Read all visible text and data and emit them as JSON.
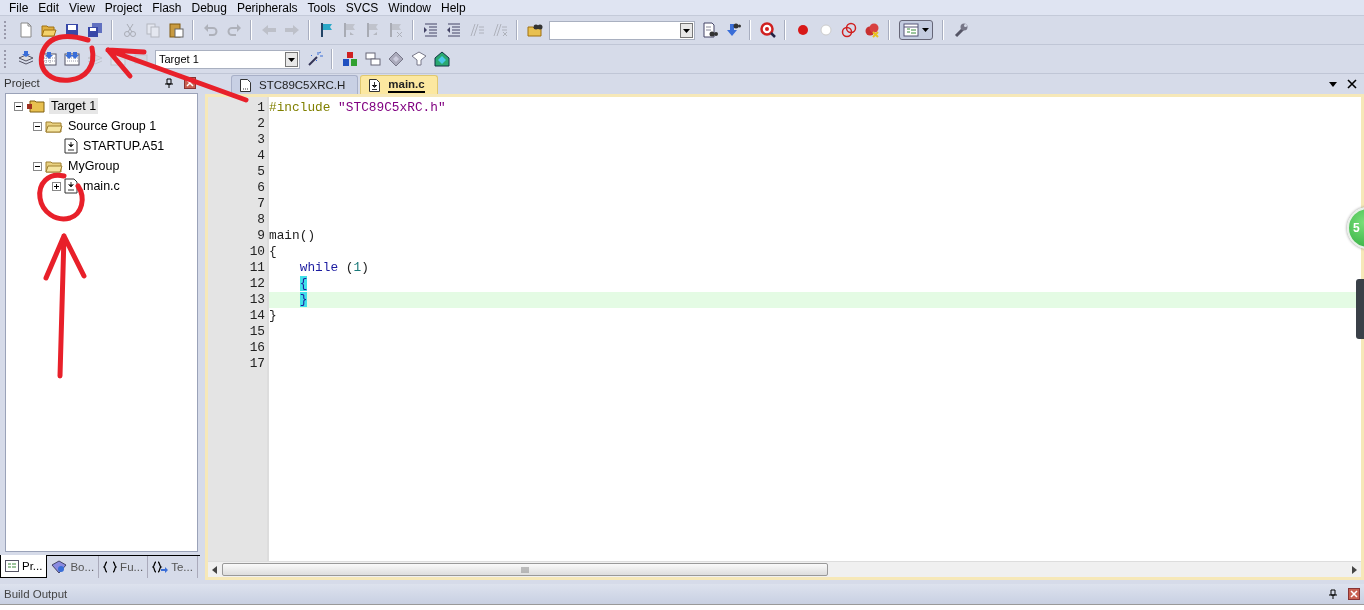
{
  "menu": [
    {
      "label": "File"
    },
    {
      "label": "Edit"
    },
    {
      "label": "View"
    },
    {
      "label": "Project"
    },
    {
      "label": "Flash"
    },
    {
      "label": "Debug"
    },
    {
      "label": "Peripherals"
    },
    {
      "label": "Tools"
    },
    {
      "label": "SVCS"
    },
    {
      "label": "Window"
    },
    {
      "label": "Help"
    }
  ],
  "toolbar_1": [
    {
      "kind": "new",
      "disabled": false
    },
    {
      "kind": "open",
      "disabled": false
    },
    {
      "kind": "save",
      "disabled": false
    },
    {
      "kind": "saveall",
      "disabled": false
    },
    {
      "kind": "sep"
    },
    {
      "kind": "cut",
      "disabled": true
    },
    {
      "kind": "copy",
      "disabled": true
    },
    {
      "kind": "paste",
      "disabled": false
    },
    {
      "kind": "sep"
    },
    {
      "kind": "undo",
      "disabled": true
    },
    {
      "kind": "redo",
      "disabled": true
    },
    {
      "kind": "sep"
    },
    {
      "kind": "back",
      "disabled": true
    },
    {
      "kind": "forward",
      "disabled": true
    },
    {
      "kind": "sep"
    },
    {
      "kind": "flag",
      "disabled": false
    },
    {
      "kind": "flagprev",
      "disabled": true
    },
    {
      "kind": "flagnext",
      "disabled": true
    },
    {
      "kind": "flagclear",
      "disabled": true
    },
    {
      "kind": "sep"
    },
    {
      "kind": "indent",
      "disabled": false
    },
    {
      "kind": "unindent",
      "disabled": false
    },
    {
      "kind": "comment",
      "disabled": true
    },
    {
      "kind": "uncomment",
      "disabled": true
    },
    {
      "kind": "sep"
    },
    {
      "kind": "findfiles",
      "disabled": false
    },
    {
      "kind": "combo"
    },
    {
      "kind": "find",
      "disabled": false
    },
    {
      "kind": "incfind",
      "disabled": false
    },
    {
      "kind": "sep"
    },
    {
      "kind": "debug",
      "disabled": false
    },
    {
      "kind": "sep"
    },
    {
      "kind": "bp",
      "disabled": false
    },
    {
      "kind": "bpoff",
      "disabled": false
    },
    {
      "kind": "bpall",
      "disabled": false
    },
    {
      "kind": "bpkill",
      "disabled": false
    },
    {
      "kind": "sep"
    },
    {
      "kind": "layout",
      "disabled": false
    },
    {
      "kind": "sep"
    },
    {
      "kind": "wrench",
      "disabled": false
    }
  ],
  "toolbar_2": [
    {
      "kind": "translate",
      "disabled": false
    },
    {
      "kind": "build",
      "disabled": false
    },
    {
      "kind": "rebuild",
      "disabled": false
    },
    {
      "kind": "batch",
      "disabled": true
    },
    {
      "kind": "download",
      "disabled": true
    },
    {
      "kind": "stop",
      "disabled": true
    },
    {
      "kind": "combo",
      "value": "Target 1"
    },
    {
      "kind": "wand",
      "disabled": false
    },
    {
      "kind": "sep"
    },
    {
      "kind": "manage",
      "disabled": false
    },
    {
      "kind": "windows",
      "disabled": false
    },
    {
      "kind": "diamond",
      "disabled": false
    },
    {
      "kind": "funnel",
      "disabled": false
    },
    {
      "kind": "packs",
      "disabled": false
    }
  ],
  "project_panel": {
    "title": "Project",
    "tree": [
      {
        "label": "Target 1",
        "kind": "target",
        "expanded": true,
        "selected": true,
        "children": [
          {
            "label": "Source Group 1",
            "kind": "folder",
            "expanded": true,
            "selected": false,
            "children": [
              {
                "label": "STARTUP.A51",
                "kind": "file",
                "selected": false
              }
            ]
          },
          {
            "label": "MyGroup",
            "kind": "folder",
            "expanded": true,
            "selected": false,
            "children": [
              {
                "label": "main.c",
                "kind": "file",
                "expanded": false,
                "selected": false
              }
            ]
          }
        ]
      }
    ],
    "tabs": [
      {
        "label": "Pr...",
        "kind": "project",
        "selected": true
      },
      {
        "label": "Bo...",
        "kind": "books",
        "selected": false
      },
      {
        "label": "Fu...",
        "kind": "functions",
        "selected": false
      },
      {
        "label": "Te...",
        "kind": "templates",
        "selected": false
      }
    ]
  },
  "editor": {
    "tabs": [
      {
        "label": "STC89C5XRC.H",
        "selected": false
      },
      {
        "label": "main.c",
        "selected": true
      }
    ],
    "lines": [
      {
        "number": "1",
        "code": [
          {
            "t": "#include",
            "kind": "pre",
            "indent": false
          },
          {
            "t": " \"STC89C5xRC.h\"",
            "kind": "string",
            "indent": false
          }
        ]
      },
      {
        "number": "2"
      },
      {
        "number": "3"
      },
      {
        "number": "4"
      },
      {
        "number": "5"
      },
      {
        "number": "6"
      },
      {
        "number": "7"
      },
      {
        "number": "8"
      },
      {
        "number": "9",
        "code": [
          {
            "t": "main()",
            "kind": "plain",
            "indent": false
          }
        ]
      },
      {
        "number": "10",
        "code": [
          {
            "t": "{",
            "kind": "plain",
            "indent": false
          }
        ]
      },
      {
        "number": "11",
        "code": [
          {
            "t": "while",
            "kind": "keyword",
            "indent": true
          },
          {
            "t": " (",
            "kind": "plain"
          },
          {
            "t": "1",
            "kind": "number"
          },
          {
            "t": ")",
            "kind": "plain"
          }
        ]
      },
      {
        "number": "12",
        "code": [
          {
            "t": "{",
            "kind": "brace",
            "indent": true
          }
        ]
      },
      {
        "number": "13",
        "current": true,
        "code": [
          {
            "t": "}",
            "kind": "brace",
            "indent": true
          }
        ]
      },
      {
        "number": "14",
        "code": [
          {
            "t": "}",
            "kind": "plain",
            "indent": false
          }
        ]
      },
      {
        "number": "15"
      },
      {
        "number": "16"
      },
      {
        "number": "17"
      }
    ]
  },
  "floating_badge": {
    "text": "5"
  },
  "build_output": {
    "title": "Build Output"
  }
}
